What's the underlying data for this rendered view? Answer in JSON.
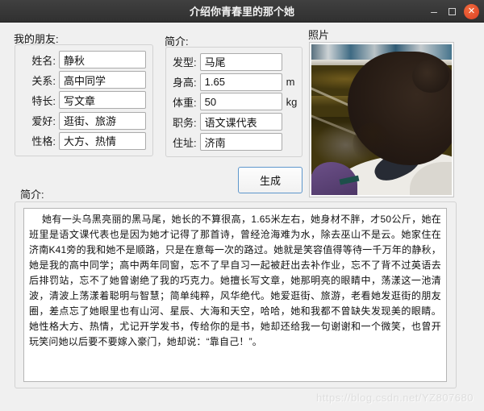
{
  "window": {
    "title": "介绍你青春里的那个她"
  },
  "titlebar": {
    "minimize_glyph": "–",
    "close_glyph": "✕"
  },
  "friend_panel": {
    "title": "我的朋友:",
    "fields": [
      {
        "label": "姓名:",
        "value": "静秋"
      },
      {
        "label": "关系:",
        "value": "高中同学"
      },
      {
        "label": "特长:",
        "value": "写文章"
      },
      {
        "label": "爱好:",
        "value": "逛街、旅游"
      },
      {
        "label": "性格:",
        "value": "大方、热情"
      }
    ]
  },
  "profile_panel": {
    "title": "简介:",
    "fields": [
      {
        "label": "发型:",
        "value": "马尾",
        "unit": ""
      },
      {
        "label": "身高:",
        "value": "1.65",
        "unit": "m"
      },
      {
        "label": "体重:",
        "value": "50",
        "unit": "kg"
      },
      {
        "label": "职务:",
        "value": "语文课代表",
        "unit": ""
      },
      {
        "label": "住址:",
        "value": "济南",
        "unit": ""
      }
    ]
  },
  "generate_button": {
    "label": "生成"
  },
  "photo_panel": {
    "title": "照片"
  },
  "summary_panel": {
    "title": "简介:",
    "text": "她有一头乌黑亮丽的黑马尾，她长的不算很高，1.65米左右，她身材不胖，才50公斤，她在班里是语文课代表也是因为她才记得了那首诗，曾经沧海难为水，除去巫山不是云。她家住在济南K41旁的我和她不是顺路，只是在意每一次的路过。她就是笑容值得等待一千万年的静秋，她是我的高中同学；高中两年同窗，忘不了早自习一起被赶出去补作业，忘不了背不过英语去后排罚站，忘不了她曾谢绝了我的巧克力。她擅长写文章，她那明亮的眼睛中，荡漾这一池清波，清波上荡漾着聪明与智慧；简单纯粹，风华绝代。她爱逛街、旅游，老看她发逛街的朋友圈，差点忘了她眼里也有山河、星辰、大海和天空，哈哈，她和我都不曾缺失发现美的眼睛。她性格大方、热情，尤记开学发书，传给你的是书，她却还给我一句谢谢和一个微笑，也曾开玩笑问她以后要不要嫁入豪门，她却说：“靠自己！”。"
  },
  "watermark": {
    "text": "https://blog.csdn.net/YZ807680"
  },
  "colors": {
    "close_button": "#dd4025",
    "button_focus_border": "#5e97cc",
    "titlebar": "#383838",
    "window_bg": "#f0f0f0"
  }
}
